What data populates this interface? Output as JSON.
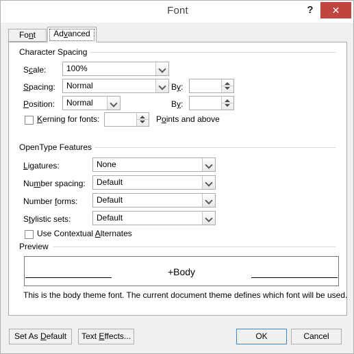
{
  "window": {
    "title": "Font",
    "help_label": "?",
    "close_label": "✕"
  },
  "tabs": [
    {
      "label": "Font",
      "accel": "n",
      "active": false
    },
    {
      "label": "Advanced",
      "accel": "v",
      "active": true
    }
  ],
  "character_spacing": {
    "group_title": "Character Spacing",
    "scale": {
      "label": "Scale:",
      "value": "100%"
    },
    "spacing": {
      "label": "Spacing:",
      "value": "Normal"
    },
    "spacing_by": {
      "label": "By:",
      "value": ""
    },
    "position": {
      "label": "Position:",
      "value": "Normal"
    },
    "position_by": {
      "label": "By:",
      "value": ""
    },
    "kerning": {
      "label": "Kerning for fonts:",
      "checked": false,
      "value": "",
      "suffix": "Points and above"
    }
  },
  "opentype_features": {
    "group_title": "OpenType Features",
    "ligatures": {
      "label": "Ligatures:",
      "value": "None"
    },
    "number_spacing": {
      "label": "Number spacing:",
      "value": "Default"
    },
    "number_forms": {
      "label": "Number forms:",
      "value": "Default"
    },
    "stylistic_sets": {
      "label": "Stylistic sets:",
      "value": "Default"
    },
    "contextual_alternates": {
      "label": "Use Contextual Alternates",
      "checked": false
    }
  },
  "preview": {
    "group_title": "Preview",
    "sample_text": "+Body",
    "description": "This is the body theme font. The current document theme defines which font will be used."
  },
  "footer": {
    "set_as_default": "Set As Default",
    "text_effects": "Text Effects...",
    "ok": "OK",
    "cancel": "Cancel"
  },
  "colors": {
    "close_red": "#c1453f",
    "default_button_border": "#3a87cd",
    "dialog_background": "#f0f0f0",
    "panel_background": "#ffffff"
  }
}
